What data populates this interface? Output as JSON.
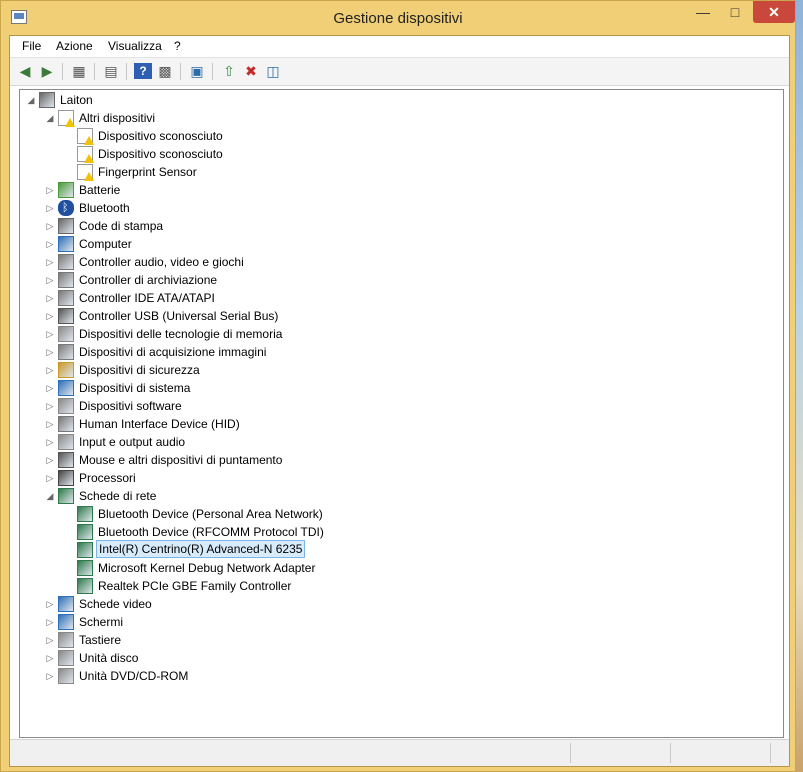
{
  "window": {
    "title": "Gestione dispositivi"
  },
  "menu": {
    "items": [
      "File",
      "Azione",
      "Visualizza",
      "?"
    ]
  },
  "toolbar": {
    "buttons": [
      "back-icon",
      "forward-icon",
      "show-hide-tree-icon",
      "properties-icon",
      "help-icon",
      "view-icon",
      "scan-hardware-icon",
      "update-driver-icon",
      "disable-device-icon",
      "uninstall-icon"
    ]
  },
  "tree": {
    "root": "Laiton",
    "categories": [
      {
        "label": "Altri dispositivi",
        "expanded": true,
        "icon": "unknown-device-icon",
        "children": [
          "Dispositivo sconosciuto",
          "Dispositivo sconosciuto",
          "Fingerprint Sensor"
        ]
      },
      {
        "label": "Batterie",
        "icon": "battery-icon"
      },
      {
        "label": "Bluetooth",
        "icon": "bluetooth-icon"
      },
      {
        "label": "Code di stampa",
        "icon": "printer-icon"
      },
      {
        "label": "Computer",
        "icon": "computer-icon"
      },
      {
        "label": "Controller audio, video e giochi",
        "icon": "speaker-icon"
      },
      {
        "label": "Controller di archiviazione",
        "icon": "storage-controller-icon"
      },
      {
        "label": "Controller IDE ATA/ATAPI",
        "icon": "ide-icon"
      },
      {
        "label": "Controller USB (Universal Serial Bus)",
        "icon": "usb-icon"
      },
      {
        "label": "Dispositivi delle tecnologie di memoria",
        "icon": "memory-icon"
      },
      {
        "label": "Dispositivi di acquisizione immagini",
        "icon": "camera-icon"
      },
      {
        "label": "Dispositivi di sicurezza",
        "icon": "key-icon"
      },
      {
        "label": "Dispositivi di sistema",
        "icon": "system-icon"
      },
      {
        "label": "Dispositivi software",
        "icon": "software-device-icon"
      },
      {
        "label": "Human Interface Device (HID)",
        "icon": "hid-icon"
      },
      {
        "label": "Input e output audio",
        "icon": "audio-io-icon"
      },
      {
        "label": "Mouse e altri dispositivi di puntamento",
        "icon": "mouse-icon"
      },
      {
        "label": "Processori",
        "icon": "cpu-icon"
      },
      {
        "label": "Schede di rete",
        "expanded": true,
        "icon": "network-icon",
        "children": [
          "Bluetooth Device (Personal Area Network)",
          "Bluetooth Device (RFCOMM Protocol TDI)",
          "Intel(R) Centrino(R) Advanced-N 6235",
          "Microsoft Kernel Debug Network Adapter",
          "Realtek PCIe GBE Family Controller"
        ],
        "selected_child": "Intel(R) Centrino(R) Advanced-N 6235"
      },
      {
        "label": "Schede video",
        "icon": "display-adapter-icon"
      },
      {
        "label": "Schermi",
        "icon": "monitor-icon"
      },
      {
        "label": "Tastiere",
        "icon": "keyboard-icon"
      },
      {
        "label": "Unità disco",
        "icon": "disk-icon"
      },
      {
        "label": "Unità DVD/CD-ROM",
        "icon": "dvd-icon"
      }
    ]
  },
  "colors": {
    "frame": "#f0cf76",
    "close": "#c9473b",
    "selection": "#d8ebfb",
    "selection_border": "#7ab4e8"
  }
}
